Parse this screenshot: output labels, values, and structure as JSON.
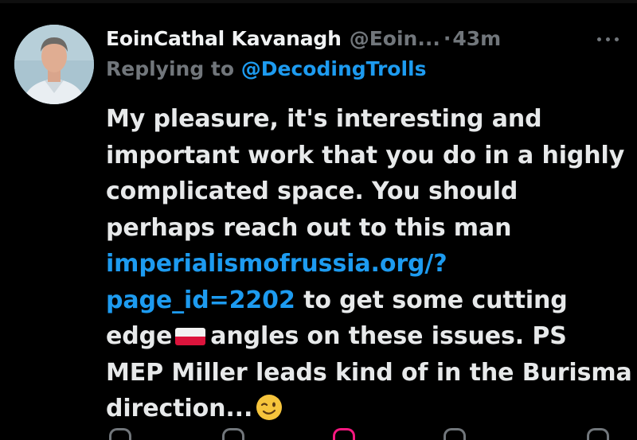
{
  "tweet": {
    "author_name": "EoinCathal Kavanagh",
    "author_handle": "@Eoin...",
    "separator": "·",
    "time": "43m",
    "replying_prefix": "Replying to",
    "replying_to": "@DecodingTrolls",
    "text_lines": [
      "My pleasure, it's interesting and",
      "important work that you do in a highly",
      "complicated space. You should",
      "perhaps reach out to this man"
    ],
    "link_part1": "imperialismofrussia.org/?",
    "link_part2": "page_id=2202",
    "after_link": " to get some cutting",
    "line7_before_flag": "edge",
    "line7_after_flag": "angles on these issues.  PS",
    "line8": "MEP Miller leads kind of in the Burisma",
    "line9": "direction...",
    "flag_icon": "poland-flag-icon",
    "emoji_icon": "winking-face-icon"
  },
  "colors": {
    "background": "#000000",
    "text": "#e7e9ea",
    "secondary": "#71767b",
    "link": "#1d9bf0"
  }
}
